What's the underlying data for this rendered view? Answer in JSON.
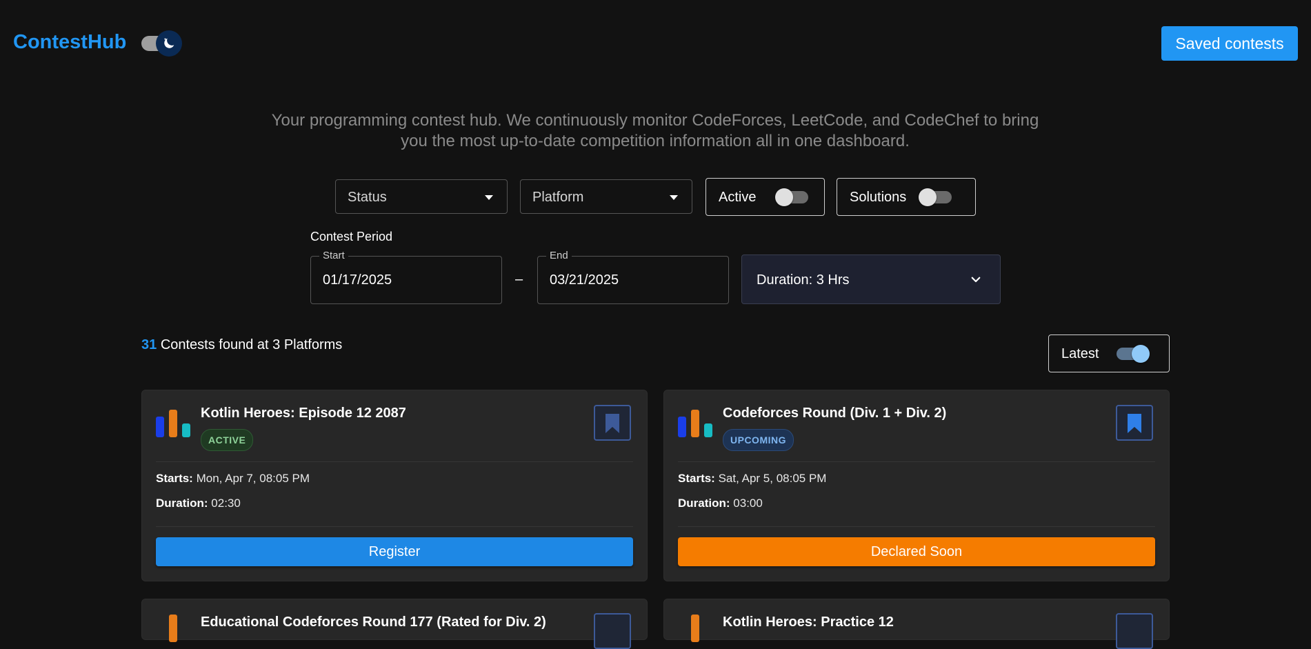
{
  "header": {
    "brand": "ContestHub",
    "saved_label": "Saved contests"
  },
  "tagline": "Your programming contest hub. We continuously monitor CodeForces, LeetCode, and CodeChef to bring you the most up-to-date competition information all in one dashboard.",
  "filters": {
    "status_label": "Status",
    "platform_label": "Platform",
    "active_label": "Active",
    "active_on": false,
    "solutions_label": "Solutions",
    "solutions_on": false
  },
  "period": {
    "label": "Contest Period",
    "start_caption": "Start",
    "start_value": "01/17/2025",
    "separator": "–",
    "end_caption": "End",
    "end_value": "03/21/2025",
    "duration_label": "Duration: 3 Hrs"
  },
  "results": {
    "count": "31",
    "text": "Contests found at 3 Platforms",
    "sort_label": "Latest",
    "sort_on": true
  },
  "colors": {
    "accent": "#2196f3",
    "warning": "#f57c00",
    "register": "#1e88e5"
  },
  "cards": [
    {
      "title": "Kotlin Heroes: Episode 12 2087",
      "status": "ACTIVE",
      "starts_label": "Starts:",
      "starts": "Mon, Apr 7, 08:05 PM",
      "duration_label": "Duration:",
      "duration": "02:30",
      "action": "Register",
      "bookmarked": false
    },
    {
      "title": "Codeforces Round (Div. 1 + Div. 2)",
      "status": "UPCOMING",
      "starts_label": "Starts:",
      "starts": "Sat, Apr 5, 08:05 PM",
      "duration_label": "Duration:",
      "duration": "03:00",
      "action": "Declared Soon",
      "bookmarked": true
    },
    {
      "title": "Educational Codeforces Round 177 (Rated for Div. 2)"
    },
    {
      "title": "Kotlin Heroes: Practice 12"
    }
  ]
}
